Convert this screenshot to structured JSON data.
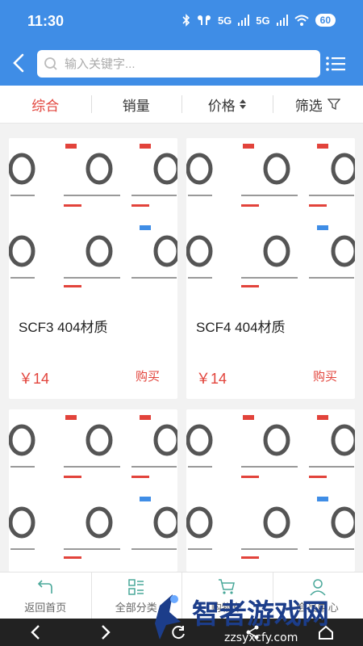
{
  "status_bar": {
    "time": "11:30",
    "network_1": "5G",
    "network_2": "5G",
    "battery": "60"
  },
  "search": {
    "placeholder": "输入关键字..."
  },
  "sort_bar": {
    "items": [
      {
        "label": "综合",
        "active": true
      },
      {
        "label": "销量",
        "active": false
      },
      {
        "label": "价格",
        "active": false
      },
      {
        "label": "筛选",
        "active": false
      }
    ]
  },
  "products": [
    {
      "title": "SCF3 404材质",
      "price": "￥14",
      "action": "购买"
    },
    {
      "title": "SCF4 404材质",
      "price": "￥14",
      "action": "购买"
    },
    {
      "title": "",
      "price": "",
      "action": ""
    },
    {
      "title": "",
      "price": "",
      "action": ""
    }
  ],
  "bottom_nav": {
    "items": [
      {
        "label": "返回首页",
        "icon": "home-return-icon"
      },
      {
        "label": "全部分类",
        "icon": "category-icon"
      },
      {
        "label": "购物车",
        "icon": "cart-icon"
      },
      {
        "label": "会员中心",
        "icon": "user-icon"
      }
    ]
  },
  "watermark": {
    "text": "智者游戏网",
    "url": "zzsyxcfy.com"
  },
  "colors": {
    "header_blue": "#3f8de6",
    "accent_red": "#e2433b"
  }
}
